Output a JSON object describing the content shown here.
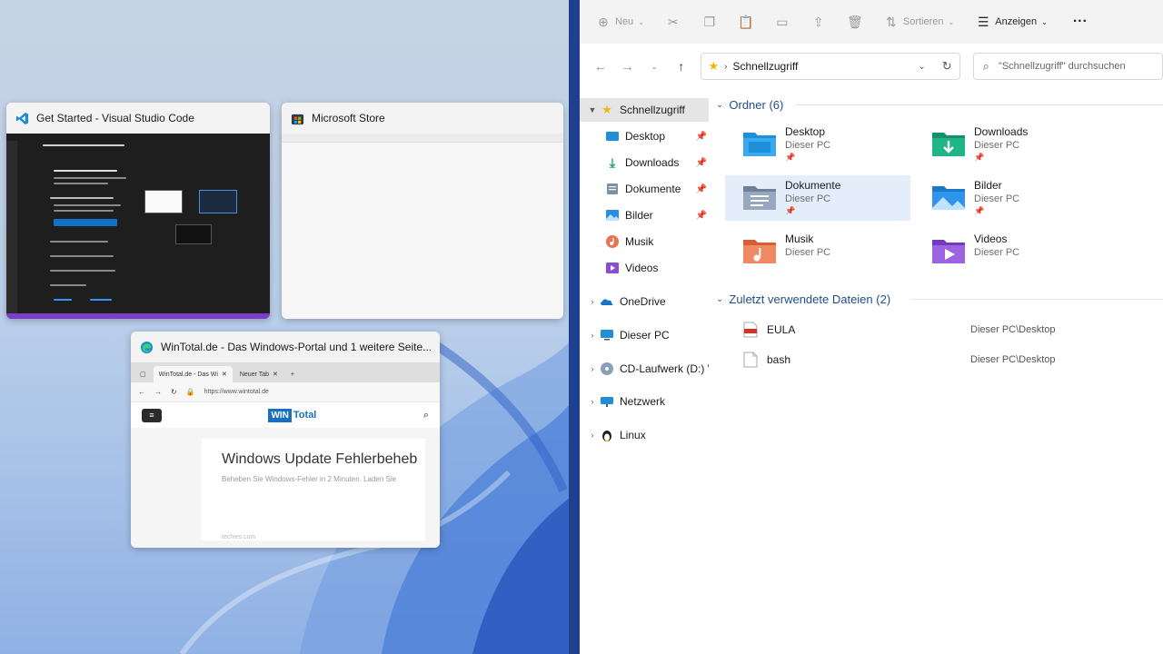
{
  "snap_assist": {
    "windows": [
      {
        "title": "Get Started - Visual Studio Code",
        "icon": "vscode-icon"
      },
      {
        "title": "Microsoft Store",
        "icon": "store-icon"
      },
      {
        "title": "WinTotal.de - Das Windows-Portal und 1 weitere Seite...",
        "icon": "edge-icon"
      }
    ],
    "edge_preview": {
      "tab1": "WinTotal.de - Das Wi",
      "tab2": "Neuer Tab",
      "url": "https://www.wintotal.de",
      "logo_a": "WIN",
      "logo_b": "Total",
      "headline": "Windows Update Fehlerbeheb",
      "subline": "Beheben Sie Windows-Fehler in 2 Minuten. Laden Sie",
      "footer": "techies.com"
    }
  },
  "explorer": {
    "toolbar": {
      "new_label": "Neu",
      "sort_label": "Sortieren",
      "view_label": "Anzeigen",
      "more_label": "···"
    },
    "address": {
      "path": "Schnellzugriff"
    },
    "search": {
      "placeholder": "\"Schnellzugriff\" durchsuchen"
    },
    "nav": {
      "quick_access": "Schnellzugriff",
      "pinned": [
        {
          "label": "Desktop",
          "pinned": true
        },
        {
          "label": "Downloads",
          "pinned": true
        },
        {
          "label": "Dokumente",
          "pinned": true
        },
        {
          "label": "Bilder",
          "pinned": true
        },
        {
          "label": "Musik",
          "pinned": false
        },
        {
          "label": "Videos",
          "pinned": false
        }
      ],
      "roots": [
        {
          "label": "OneDrive"
        },
        {
          "label": "Dieser PC"
        },
        {
          "label": "CD-Laufwerk (D:) Vi"
        },
        {
          "label": "Netzwerk"
        },
        {
          "label": "Linux"
        }
      ]
    },
    "folders_group": {
      "label": "Ordner (6)"
    },
    "folders": [
      {
        "name": "Desktop",
        "location": "Dieser PC",
        "color": "#1e8fd8"
      },
      {
        "name": "Downloads",
        "location": "Dieser PC",
        "color": "#1aa37a"
      },
      {
        "name": "Dokumente",
        "location": "Dieser PC",
        "color": "#7f8fa6"
      },
      {
        "name": "Bilder",
        "location": "Dieser PC",
        "color": "#2a8ee0"
      },
      {
        "name": "Musik",
        "location": "Dieser PC",
        "color": "#e8734e"
      },
      {
        "name": "Videos",
        "location": "Dieser PC",
        "color": "#8a4fd0"
      }
    ],
    "recent_group": {
      "label": "Zuletzt verwendete Dateien (2)"
    },
    "recent": [
      {
        "name": "EULA",
        "location": "Dieser PC\\Desktop",
        "icon": "pdf-file-icon"
      },
      {
        "name": "bash",
        "location": "Dieser PC\\Desktop",
        "icon": "generic-file-icon"
      }
    ]
  }
}
